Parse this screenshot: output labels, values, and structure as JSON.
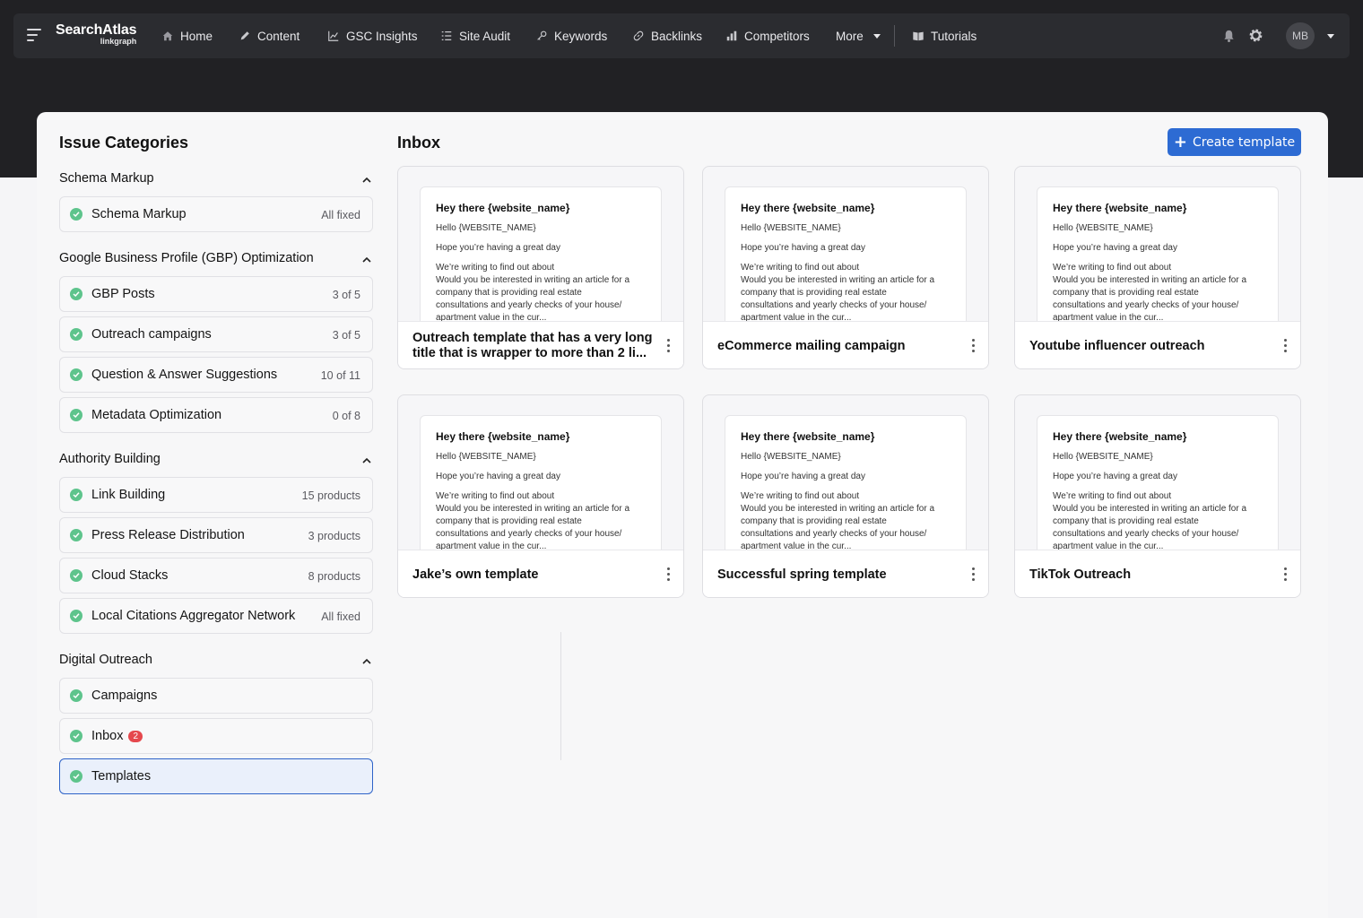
{
  "nav": {
    "brand": "SearchAtlas",
    "brand_sub": "linkgraph",
    "items": [
      "Home",
      "Content",
      "GSC Insights",
      "Site Audit",
      "Keywords",
      "Backlinks",
      "Competitors",
      "More",
      "Tutorials"
    ],
    "avatar_initials": "MB"
  },
  "sidebar": {
    "title": "Issue Categories",
    "groups": [
      {
        "name": "Schema Markup",
        "items": [
          {
            "label": "Schema Markup",
            "meta": "All fixed"
          }
        ]
      },
      {
        "name": "Google Business Profile (GBP) Optimization",
        "items": [
          {
            "label": "GBP Posts",
            "meta": "3 of 5"
          },
          {
            "label": "Outreach campaigns",
            "meta": "3 of 5"
          },
          {
            "label": "Question & Answer Suggestions",
            "meta": "10 of 11"
          },
          {
            "label": "Metadata Optimization",
            "meta": "0 of 8"
          }
        ]
      },
      {
        "name": "Authority Building",
        "items": [
          {
            "label": "Link Building",
            "meta": "15 products"
          },
          {
            "label": "Press Release Distribution",
            "meta": "3 products"
          },
          {
            "label": "Cloud Stacks",
            "meta": "8 products"
          },
          {
            "label": "Local Citations Aggregator Network",
            "meta": "All fixed"
          }
        ]
      },
      {
        "name": "Digital Outreach",
        "items": [
          {
            "label": "Campaigns",
            "meta": ""
          },
          {
            "label": "Inbox",
            "meta": "",
            "badge": "2"
          },
          {
            "label": "Templates",
            "meta": "",
            "active": true
          }
        ]
      }
    ]
  },
  "main": {
    "title": "Inbox",
    "create_label": "Create template",
    "preview": {
      "greeting": "Hey there {website_name}",
      "hello": "Hello {WEBSITE_NAME}",
      "hope": "Hope you’re having a great day",
      "lines": [
        "We’re writing to find out about",
        "Would you be interested in writing an article for a",
        "company that is providing real estate",
        "consultations and yearly checks of your house/",
        "apartment value in the cur..."
      ]
    },
    "templates": [
      "Outreach template that has a very long title that is wrapper to more than 2 li...",
      "eCommerce mailing campaign",
      "Youtube influencer outreach",
      "Jake’s own template",
      "Successful spring template",
      "TikTok Outreach"
    ]
  }
}
